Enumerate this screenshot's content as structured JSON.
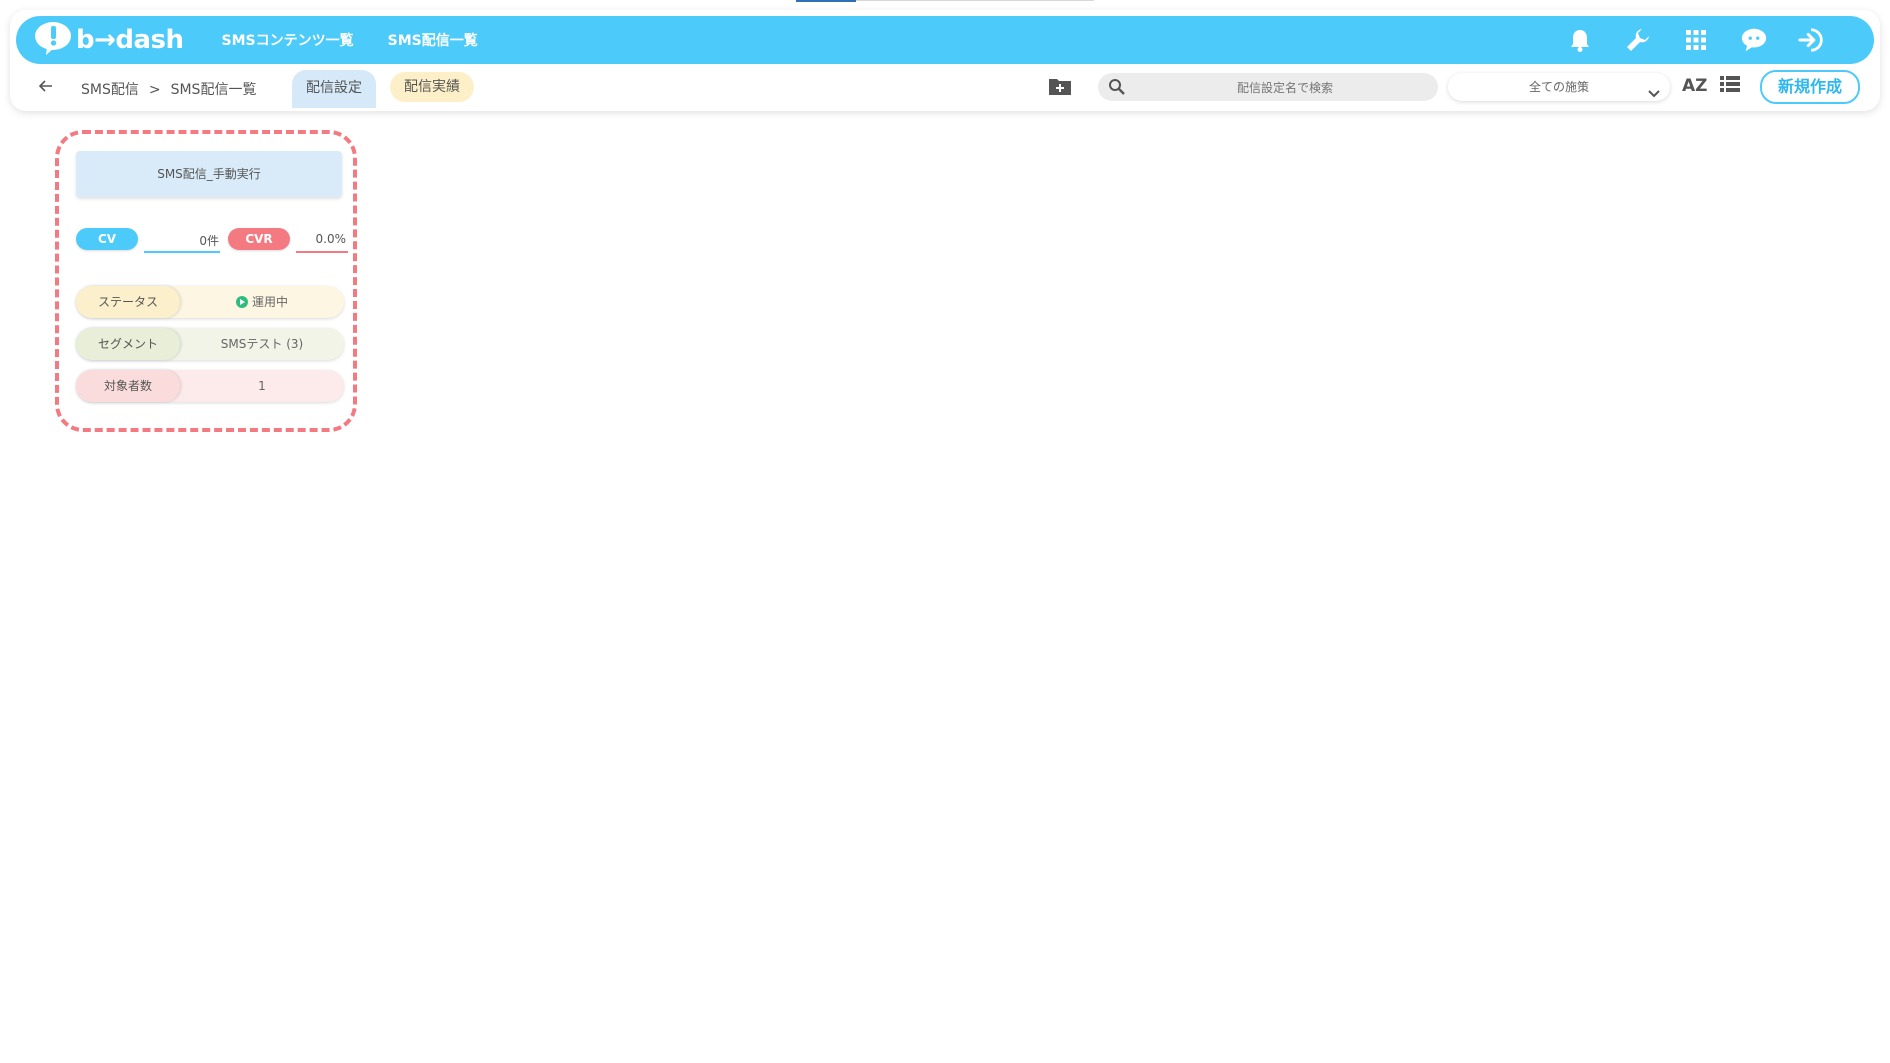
{
  "app": {
    "logo_text": "b→dash"
  },
  "header": {
    "nav": [
      "SMSコンテンツ一覧",
      "SMS配信一覧"
    ],
    "icons": [
      "bell-icon",
      "wrench-icon",
      "grid-icon",
      "chat-icon",
      "logout-icon"
    ],
    "accent_color": "#4ccbfb"
  },
  "subbar": {
    "breadcrumb": [
      "SMS配信",
      "SMS配信一覧"
    ],
    "breadcrumb_sep": ">",
    "tabs": [
      "配信設定",
      "配信実績"
    ],
    "search_placeholder": "配信設定名で検索",
    "filter_selected": "全ての施策",
    "sort_label": "AZ",
    "new_button": "新規作成"
  },
  "card": {
    "title": "SMS配信_手動実行",
    "cv_label": "CV",
    "cv_value": "0件",
    "cvr_label": "CVR",
    "cvr_value": "0.0%",
    "rows": [
      {
        "label": "ステータス",
        "value": "運用中"
      },
      {
        "label": "セグメント",
        "value": "SMSテスト (3)"
      },
      {
        "label": "対象者数",
        "value": "1"
      }
    ],
    "highlight_color": "#f47a82"
  }
}
